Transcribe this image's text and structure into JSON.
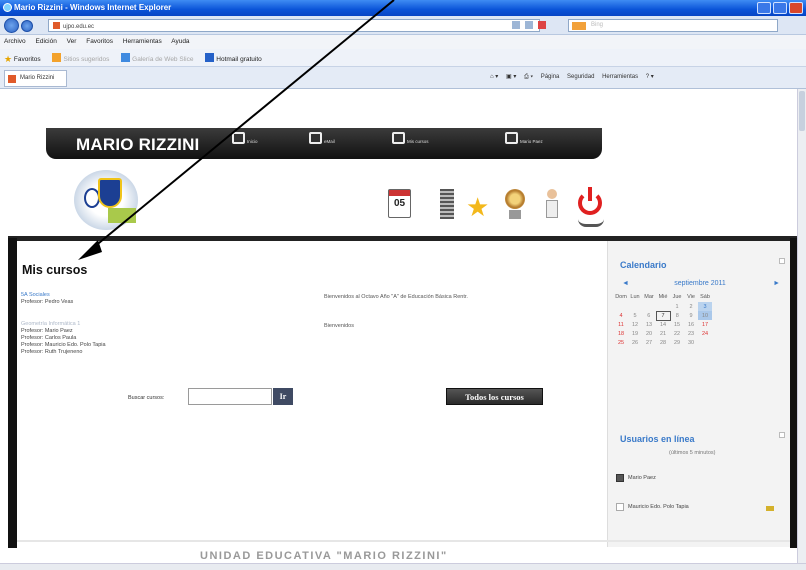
{
  "browser": {
    "title": "Mario Rizzini - Windows Internet Explorer",
    "url_domain": "ujpo.edu.ec",
    "search_placeholder": "Bing",
    "menu": [
      "Archivo",
      "Edición",
      "Ver",
      "Favoritos",
      "Herramientas",
      "Ayuda"
    ],
    "favorites_label": "Favoritos",
    "favorites": [
      "Sitios sugeridos",
      "Galería de Web Slice",
      "Hotmail gratuito"
    ],
    "tab_title": "Mario Rizzini",
    "commands": [
      "Página",
      "Seguridad",
      "Herramientas"
    ]
  },
  "site": {
    "title": "MARIO RIZZINI",
    "menu": [
      "Inicio",
      "eMail",
      "Mis cursos",
      "Mario Paez"
    ]
  },
  "icons": {
    "calendar_day": "05"
  },
  "main": {
    "heading": "Mis cursos",
    "courses": [
      {
        "name": "5A Sociales",
        "teachers": [
          "Profesor: Pedro Veas"
        ],
        "welcome": "Bienvenidos al Octavo Año \"A\" de Educación Básica Rentr."
      },
      {
        "name": "Geometría Informática 1",
        "teachers": [
          "Profesor: Mario Paez",
          "Profesor: Carlos Paula",
          "Profesor: Mauricio Edo. Polo Tapia",
          "Profesor: Ruth Trujeneno"
        ],
        "welcome": "Bienvenidos"
      }
    ],
    "search_label": "Buscar cursos:",
    "search_value": "",
    "search_button": "Ir",
    "all_courses_button": "Todos los cursos"
  },
  "sidebar": {
    "calendar": {
      "title": "Calendario",
      "month": "septiembre 2011",
      "prev": "◄",
      "next": "►",
      "weekdays": [
        "Dom",
        "Lun",
        "Mar",
        "Mié",
        "Jue",
        "Vie",
        "Sáb"
      ],
      "weeks": [
        [
          "",
          "",
          "",
          "",
          "1",
          "2",
          "3"
        ],
        [
          "4",
          "5",
          "6",
          "7",
          "8",
          "9",
          "10"
        ],
        [
          "11",
          "12",
          "13",
          "14",
          "15",
          "16",
          "17"
        ],
        [
          "18",
          "19",
          "20",
          "21",
          "22",
          "23",
          "24"
        ],
        [
          "25",
          "26",
          "27",
          "28",
          "29",
          "30",
          ""
        ]
      ],
      "today": "7"
    },
    "online": {
      "title": "Usuarios en línea",
      "subtitle": "(últimos 5 minutos)",
      "users": [
        "Mario Paez",
        "Mauricio Edo. Polo Tapia"
      ]
    }
  },
  "footer": {
    "text": "UNIDAD EDUCATIVA \"MARIO RIZZINI\""
  }
}
